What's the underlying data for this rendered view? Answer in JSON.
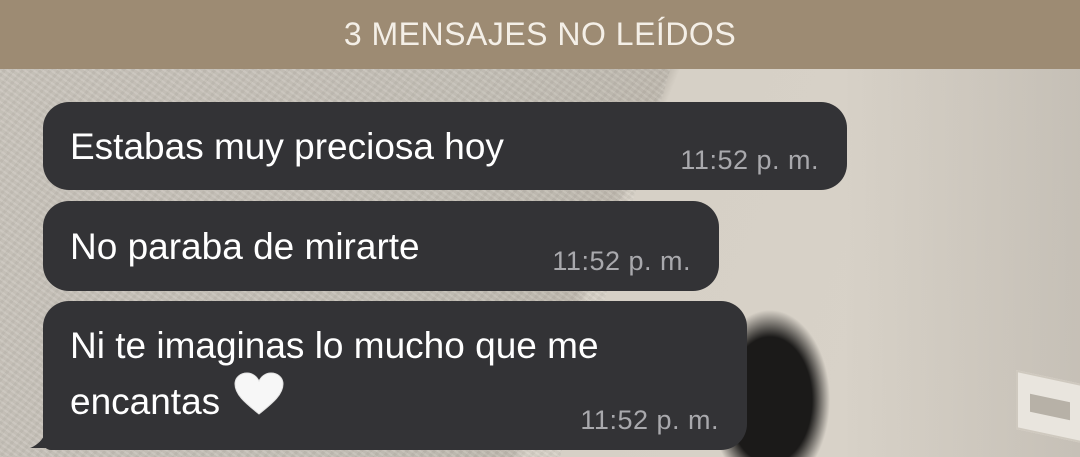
{
  "unread_banner": {
    "text": "3 MENSAJES NO LEÍDOS"
  },
  "messages": [
    {
      "text": "Estabas muy preciosa hoy",
      "time": "11:52 p. m."
    },
    {
      "text": "No paraba de mirarte",
      "time": "11:52 p. m."
    },
    {
      "line1": "Ni te imaginas lo mucho que me",
      "line2": "encantas",
      "emoji": "white-heart-icon",
      "time": "11:52 p. m."
    }
  ],
  "colors": {
    "bubble": "#333336",
    "banner": "#9d8b73",
    "time_text": "#a9a9ad",
    "message_text": "#ffffff"
  }
}
